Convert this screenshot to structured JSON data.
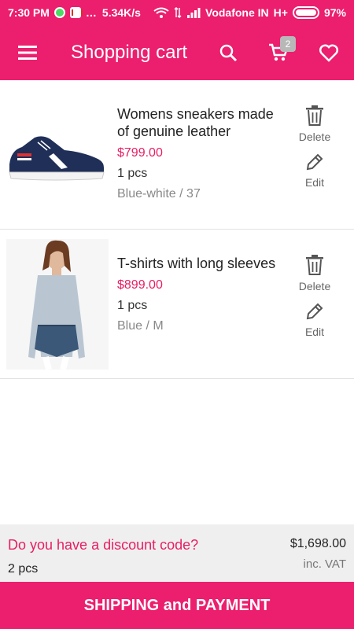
{
  "status_bar": {
    "time": "7:30 PM",
    "speed": "5.34K/s",
    "carrier": "Vodafone IN",
    "network": "H+",
    "battery": "97%"
  },
  "app_bar": {
    "title": "Shopping cart",
    "cart_badge": "2"
  },
  "cart": {
    "items": [
      {
        "name": "Womens sneakers made of genuine leather",
        "price": "$799.00",
        "qty": "1 pcs",
        "variant": "Blue-white / 37",
        "delete_label": "Delete",
        "edit_label": "Edit"
      },
      {
        "name": "T-shirts with long sleeves",
        "price": "$899.00",
        "qty": "1 pcs",
        "variant": "Blue / M",
        "delete_label": "Delete",
        "edit_label": "Edit"
      }
    ]
  },
  "summary": {
    "discount_text": "Do you have a discount code?",
    "count": "2 pcs",
    "total": "$1,698.00",
    "vat": "inc. VAT"
  },
  "checkout": {
    "label": "SHIPPING and PAYMENT"
  },
  "colors": {
    "primary": "#ec1e6e",
    "price": "#e91e63"
  }
}
